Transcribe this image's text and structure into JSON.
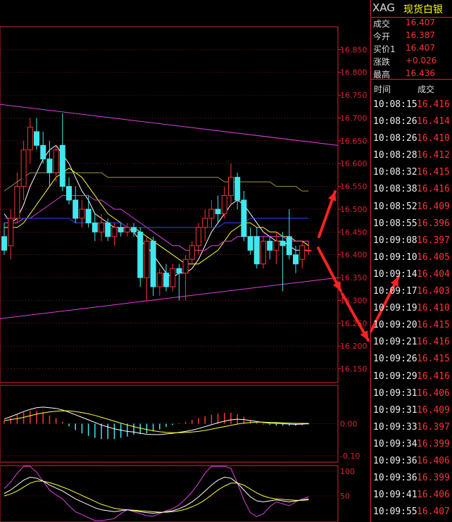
{
  "header": {
    "symbol": "XAG",
    "name": "现货白银"
  },
  "quote": [
    {
      "label": "成交",
      "value": "16.407"
    },
    {
      "label": "今开",
      "value": "16.387"
    },
    {
      "label": "买价1",
      "value": "16.407"
    },
    {
      "label": "涨跌",
      "value": "+0.026"
    },
    {
      "label": "最高",
      "value": "16.436"
    }
  ],
  "ticks_header": {
    "time": "时间",
    "price": "成交"
  },
  "ticks": [
    {
      "time": "10:08:15",
      "price": "16.416"
    },
    {
      "time": "10:08:26",
      "price": "16.414"
    },
    {
      "time": "10:08:26",
      "price": "16.410"
    },
    {
      "time": "10:08:28",
      "price": "16.412"
    },
    {
      "time": "10:08:32",
      "price": "16.415"
    },
    {
      "time": "10:08:38",
      "price": "16.416"
    },
    {
      "time": "10:08:52",
      "price": "16.409"
    },
    {
      "time": "10:08:55",
      "price": "16.396"
    },
    {
      "time": "10:09:08",
      "price": "16.397"
    },
    {
      "time": "10:09:10",
      "price": "16.405"
    },
    {
      "time": "10:09:14",
      "price": "16.404"
    },
    {
      "time": "10:09:17",
      "price": "16.403"
    },
    {
      "time": "10:09:19",
      "price": "16.410"
    },
    {
      "time": "10:09:20",
      "price": "16.415"
    },
    {
      "time": "10:09:21",
      "price": "16.416"
    },
    {
      "time": "10:09:26",
      "price": "16.415"
    },
    {
      "time": "10:09:29",
      "price": "16.416"
    },
    {
      "time": "10:09:31",
      "price": "16.406"
    },
    {
      "time": "10:09:31",
      "price": "16.409"
    },
    {
      "time": "10:09:33",
      "price": "16.397"
    },
    {
      "time": "10:09:34",
      "price": "16.399"
    },
    {
      "time": "10:09:36",
      "price": "16.406"
    },
    {
      "time": "10:09:36",
      "price": "16.399"
    },
    {
      "time": "10:09:41",
      "price": "16.406"
    },
    {
      "time": "10:09:55",
      "price": "16.407"
    }
  ],
  "chart_data": {
    "type": "candlestick",
    "colors": {
      "up": "#ff3333",
      "down": "#40e8f0",
      "axis": "#dd2233",
      "trendline": "#e040e0",
      "ma5": "#ffffff",
      "ma10": "#ffff33",
      "ma20": "#e040e0",
      "ma30": "#22dd22",
      "ma60": "#3344ff",
      "ma120": "#999944"
    },
    "price_axis": {
      "range": [
        16.12,
        16.9
      ],
      "ticks": [
        16.15,
        16.2,
        16.25,
        16.3,
        16.35,
        16.4,
        16.45,
        16.5,
        16.55,
        16.6,
        16.65,
        16.7,
        16.75,
        16.8,
        16.85
      ],
      "tick_labels": [
        "16.150",
        "16.200",
        "16.250",
        "16.300",
        "16.350",
        "16.400",
        "16.450",
        "16.500",
        "16.550",
        "16.600",
        "16.650",
        "16.700",
        "16.750",
        "16.800",
        "16.850"
      ]
    },
    "candles": [
      {
        "o": 16.44,
        "h": 16.47,
        "l": 16.4,
        "c": 16.41
      },
      {
        "o": 16.42,
        "h": 16.5,
        "l": 16.39,
        "c": 16.48
      },
      {
        "o": 16.48,
        "h": 16.58,
        "l": 16.47,
        "c": 16.55
      },
      {
        "o": 16.55,
        "h": 16.65,
        "l": 16.52,
        "c": 16.63
      },
      {
        "o": 16.63,
        "h": 16.7,
        "l": 16.6,
        "c": 16.68
      },
      {
        "o": 16.67,
        "h": 16.7,
        "l": 16.63,
        "c": 16.64
      },
      {
        "o": 16.64,
        "h": 16.67,
        "l": 16.6,
        "c": 16.61
      },
      {
        "o": 16.61,
        "h": 16.65,
        "l": 16.55,
        "c": 16.58
      },
      {
        "o": 16.58,
        "h": 16.64,
        "l": 16.56,
        "c": 16.63
      },
      {
        "o": 16.64,
        "h": 16.71,
        "l": 16.54,
        "c": 16.55
      },
      {
        "o": 16.55,
        "h": 16.57,
        "l": 16.51,
        "c": 16.52
      },
      {
        "o": 16.52,
        "h": 16.55,
        "l": 16.47,
        "c": 16.48
      },
      {
        "o": 16.48,
        "h": 16.52,
        "l": 16.46,
        "c": 16.5
      },
      {
        "o": 16.5,
        "h": 16.53,
        "l": 16.46,
        "c": 16.47
      },
      {
        "o": 16.47,
        "h": 16.49,
        "l": 16.43,
        "c": 16.45
      },
      {
        "o": 16.45,
        "h": 16.49,
        "l": 16.43,
        "c": 16.47
      },
      {
        "o": 16.47,
        "h": 16.48,
        "l": 16.43,
        "c": 16.44
      },
      {
        "o": 16.44,
        "h": 16.47,
        "l": 16.42,
        "c": 16.46
      },
      {
        "o": 16.46,
        "h": 16.47,
        "l": 16.44,
        "c": 16.45
      },
      {
        "o": 16.45,
        "h": 16.47,
        "l": 16.44,
        "c": 16.46
      },
      {
        "o": 16.46,
        "h": 16.47,
        "l": 16.44,
        "c": 16.45
      },
      {
        "o": 16.45,
        "h": 16.46,
        "l": 16.33,
        "c": 16.35
      },
      {
        "o": 16.35,
        "h": 16.44,
        "l": 16.3,
        "c": 16.43
      },
      {
        "o": 16.43,
        "h": 16.44,
        "l": 16.31,
        "c": 16.33
      },
      {
        "o": 16.33,
        "h": 16.37,
        "l": 16.31,
        "c": 16.36
      },
      {
        "o": 16.36,
        "h": 16.38,
        "l": 16.32,
        "c": 16.33
      },
      {
        "o": 16.33,
        "h": 16.38,
        "l": 16.32,
        "c": 16.37
      },
      {
        "o": 16.37,
        "h": 16.38,
        "l": 16.3,
        "c": 16.36
      },
      {
        "o": 16.36,
        "h": 16.4,
        "l": 16.3,
        "c": 16.39
      },
      {
        "o": 16.39,
        "h": 16.43,
        "l": 16.38,
        "c": 16.42
      },
      {
        "o": 16.42,
        "h": 16.47,
        "l": 16.4,
        "c": 16.46
      },
      {
        "o": 16.46,
        "h": 16.5,
        "l": 16.43,
        "c": 16.48
      },
      {
        "o": 16.48,
        "h": 16.52,
        "l": 16.46,
        "c": 16.5
      },
      {
        "o": 16.5,
        "h": 16.53,
        "l": 16.47,
        "c": 16.49
      },
      {
        "o": 16.49,
        "h": 16.55,
        "l": 16.48,
        "c": 16.53
      },
      {
        "o": 16.53,
        "h": 16.6,
        "l": 16.51,
        "c": 16.57
      },
      {
        "o": 16.57,
        "h": 16.58,
        "l": 16.5,
        "c": 16.52
      },
      {
        "o": 16.52,
        "h": 16.54,
        "l": 16.43,
        "c": 16.44
      },
      {
        "o": 16.44,
        "h": 16.46,
        "l": 16.4,
        "c": 16.41
      },
      {
        "o": 16.44,
        "h": 16.46,
        "l": 16.37,
        "c": 16.38
      },
      {
        "o": 16.38,
        "h": 16.44,
        "l": 16.37,
        "c": 16.43
      },
      {
        "o": 16.43,
        "h": 16.44,
        "l": 16.39,
        "c": 16.41
      },
      {
        "o": 16.41,
        "h": 16.45,
        "l": 16.38,
        "c": 16.43
      },
      {
        "o": 16.43,
        "h": 16.45,
        "l": 16.32,
        "c": 16.42
      },
      {
        "o": 16.44,
        "h": 16.5,
        "l": 16.39,
        "c": 16.4
      },
      {
        "o": 16.4,
        "h": 16.42,
        "l": 16.36,
        "c": 16.38
      },
      {
        "o": 16.39,
        "h": 16.43,
        "l": 16.37,
        "c": 16.42
      },
      {
        "o": 16.41,
        "h": 16.43,
        "l": 16.4,
        "c": 16.41
      }
    ],
    "moving_averages": {
      "ma5": [
        16.49,
        16.47,
        16.48,
        16.51,
        16.55,
        16.58,
        16.61,
        16.63,
        16.64,
        16.62,
        16.6,
        16.57,
        16.54,
        16.52,
        16.49,
        16.48,
        16.47,
        16.46,
        16.46,
        16.46,
        16.45,
        16.43,
        16.42,
        16.4,
        16.38,
        16.36,
        16.35,
        16.36,
        16.36,
        16.37,
        16.39,
        16.42,
        16.45,
        16.47,
        16.49,
        16.51,
        16.52,
        16.51,
        16.49,
        16.47,
        16.45,
        16.44,
        16.43,
        16.43,
        16.42,
        16.41,
        16.41,
        16.41
      ],
      "ma10": [
        16.46,
        16.46,
        16.46,
        16.47,
        16.49,
        16.51,
        16.53,
        16.55,
        16.57,
        16.58,
        16.59,
        16.58,
        16.57,
        16.55,
        16.53,
        16.51,
        16.49,
        16.48,
        16.47,
        16.46,
        16.46,
        16.45,
        16.44,
        16.43,
        16.42,
        16.41,
        16.4,
        16.39,
        16.38,
        16.38,
        16.38,
        16.39,
        16.4,
        16.41,
        16.43,
        16.45,
        16.46,
        16.47,
        16.47,
        16.46,
        16.46,
        16.45,
        16.45,
        16.44,
        16.44,
        16.43,
        16.43,
        16.42
      ],
      "ma20": [
        16.47,
        16.47,
        16.47,
        16.48,
        16.48,
        16.49,
        16.5,
        16.51,
        16.52,
        16.53,
        16.53,
        16.53,
        16.53,
        16.53,
        16.52,
        16.52,
        16.51,
        16.5,
        16.5,
        16.49,
        16.48,
        16.47,
        16.46,
        16.45,
        16.44,
        16.43,
        16.42,
        16.42,
        16.41,
        16.41,
        16.41,
        16.41,
        16.42,
        16.42,
        16.43,
        16.43,
        16.44,
        16.44,
        16.44,
        16.44,
        16.44,
        16.44,
        16.44,
        16.44,
        16.43,
        16.43,
        16.43,
        16.43
      ],
      "ma60": [
        16.48,
        16.48,
        16.48,
        16.48,
        16.48,
        16.48,
        16.48,
        16.48,
        16.48,
        16.48,
        16.48,
        16.47,
        16.47,
        16.47,
        16.47,
        16.47,
        16.47,
        16.47,
        16.47,
        16.46,
        16.46,
        16.46,
        16.46,
        16.46,
        16.46,
        16.46,
        16.46,
        16.46,
        16.46,
        16.46,
        16.46,
        16.46,
        16.46,
        16.46,
        16.47,
        16.47,
        16.47,
        16.47,
        16.48,
        16.48,
        16.48,
        16.48,
        16.48,
        16.48,
        16.48,
        16.48,
        16.48,
        16.48
      ],
      "ma120": [
        16.54,
        16.55,
        16.56,
        16.57,
        16.58,
        16.58,
        16.58,
        16.58,
        16.58,
        16.58,
        16.58,
        16.58,
        16.58,
        16.58,
        16.58,
        16.58,
        16.57,
        16.57,
        16.57,
        16.57,
        16.57,
        16.57,
        16.57,
        16.57,
        16.57,
        16.57,
        16.57,
        16.57,
        16.57,
        16.57,
        16.57,
        16.57,
        16.57,
        16.57,
        16.56,
        16.56,
        16.56,
        16.56,
        16.56,
        16.56,
        16.56,
        16.56,
        16.55,
        16.55,
        16.55,
        16.55,
        16.54,
        16.54
      ]
    },
    "trendlines": [
      {
        "from": [
          0,
          16.73
        ],
        "to": [
          47,
          16.64
        ]
      },
      {
        "from": [
          0,
          16.26
        ],
        "to": [
          47,
          16.35
        ]
      }
    ],
    "macd": {
      "range": [
        -0.12,
        0.12
      ],
      "ticks": [
        0.0,
        -0.1
      ],
      "tick_labels": [
        "0.00",
        "-0.10"
      ],
      "dif": [
        0.015,
        0.022,
        0.03,
        0.038,
        0.045,
        0.05,
        0.052,
        0.05,
        0.048,
        0.043,
        0.036,
        0.028,
        0.02,
        0.012,
        0.004,
        -0.004,
        -0.01,
        -0.016,
        -0.02,
        -0.024,
        -0.026,
        -0.03,
        -0.033,
        -0.034,
        -0.034,
        -0.032,
        -0.03,
        -0.027,
        -0.024,
        -0.02,
        -0.015,
        -0.009,
        -0.003,
        0.003,
        0.008,
        0.012,
        0.014,
        0.013,
        0.01,
        0.007,
        0.004,
        0.002,
        0.001,
        0.0,
        -0.001,
        -0.002,
        -0.001,
        0.0
      ],
      "dea": [
        0.01,
        0.013,
        0.016,
        0.02,
        0.025,
        0.03,
        0.034,
        0.037,
        0.039,
        0.04,
        0.04,
        0.038,
        0.035,
        0.031,
        0.026,
        0.02,
        0.014,
        0.008,
        0.002,
        -0.004,
        -0.009,
        -0.014,
        -0.018,
        -0.022,
        -0.025,
        -0.027,
        -0.028,
        -0.028,
        -0.027,
        -0.026,
        -0.024,
        -0.021,
        -0.017,
        -0.013,
        -0.009,
        -0.005,
        -0.001,
        0.002,
        0.004,
        0.005,
        0.005,
        0.004,
        0.004,
        0.003,
        0.002,
        0.001,
        0.001,
        0.001
      ],
      "hist": [
        0.01,
        0.018,
        0.028,
        0.036,
        0.04,
        0.04,
        0.036,
        0.026,
        0.018,
        0.006,
        -0.008,
        -0.02,
        -0.03,
        -0.038,
        -0.044,
        -0.048,
        -0.048,
        -0.048,
        -0.044,
        -0.04,
        -0.034,
        -0.032,
        -0.03,
        -0.024,
        -0.018,
        -0.01,
        -0.004,
        0.002,
        0.006,
        0.012,
        0.018,
        0.024,
        0.028,
        0.032,
        0.034,
        0.034,
        0.03,
        0.022,
        0.012,
        0.004,
        -0.002,
        -0.004,
        -0.006,
        -0.006,
        -0.006,
        -0.006,
        -0.004,
        -0.002
      ]
    },
    "kdj": {
      "range": [
        0,
        100
      ],
      "ticks": [
        100,
        50
      ],
      "tick_labels": [
        "100",
        "50"
      ],
      "k": [
        55,
        62,
        72,
        82,
        88,
        86,
        80,
        72,
        66,
        60,
        52,
        44,
        38,
        32,
        26,
        22,
        20,
        18,
        20,
        22,
        20,
        18,
        16,
        15,
        16,
        18,
        20,
        24,
        30,
        38,
        48,
        60,
        72,
        82,
        88,
        86,
        76,
        62,
        48,
        40,
        38,
        40,
        42,
        40,
        38,
        40,
        42,
        44
      ],
      "d": [
        50,
        54,
        60,
        68,
        76,
        80,
        80,
        77,
        73,
        68,
        63,
        57,
        51,
        45,
        39,
        33,
        29,
        25,
        23,
        22,
        21,
        20,
        19,
        18,
        17,
        17,
        18,
        20,
        23,
        28,
        34,
        42,
        52,
        62,
        70,
        76,
        76,
        72,
        64,
        56,
        50,
        46,
        44,
        43,
        42,
        41,
        41,
        42
      ],
      "j": [
        65,
        78,
        96,
        110,
        112,
        98,
        80,
        62,
        52,
        44,
        30,
        18,
        12,
        6,
        0,
        0,
        2,
        4,
        14,
        22,
        18,
        14,
        10,
        9,
        14,
        20,
        24,
        32,
        44,
        58,
        76,
        96,
        112,
        122,
        124,
        106,
        76,
        42,
        16,
        8,
        14,
        28,
        38,
        34,
        30,
        38,
        44,
        48
      ]
    }
  }
}
